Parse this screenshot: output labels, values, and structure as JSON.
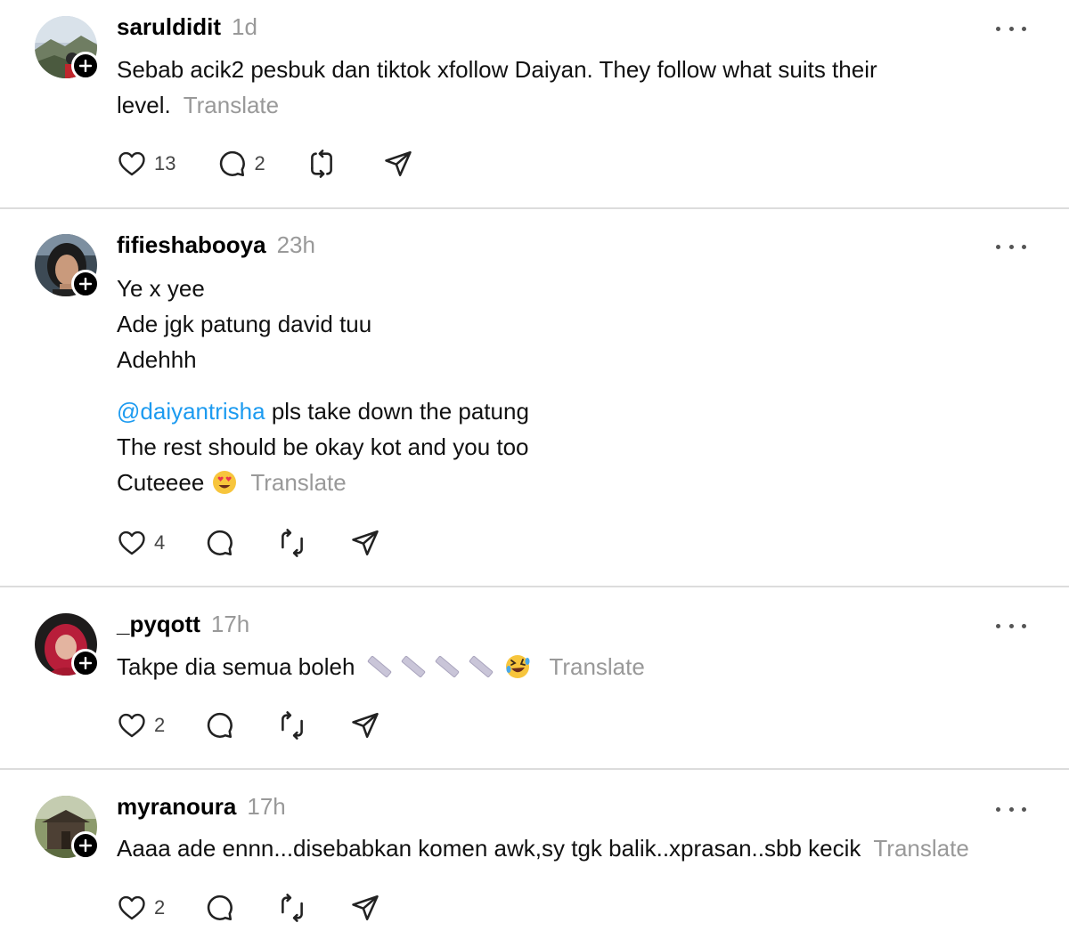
{
  "posts": [
    {
      "username": "saruldidit",
      "time": "1d",
      "lines": [
        "Sebab acik2 pesbuk dan tiktok xfollow Daiyan. They follow what suits their",
        "level."
      ],
      "translate": "Translate",
      "likes": "13",
      "replies": "2"
    },
    {
      "username": "fifieshabooya",
      "time": "23h",
      "lines_a": [
        "Ye x yee",
        "Ade jgk patung david tuu",
        "Adehhh"
      ],
      "mention": "@daiyantrisha",
      "mention_rest": " pls take down the patung",
      "lines_b": [
        "The rest should be okay kot and you too"
      ],
      "last_line": "Cuteeee",
      "translate": "Translate",
      "likes": "4"
    },
    {
      "username": "_pyqott",
      "time": "17h",
      "text": "Takpe dia semua boleh",
      "translate": "Translate",
      "likes": "2"
    },
    {
      "username": "myranoura",
      "time": "17h",
      "text": "Aaaa ade ennn...disebabkan komen awk,sy tgk balik..xprasan..sbb kecik",
      "translate": "Translate",
      "likes": "2"
    }
  ],
  "icons": {
    "like": "heart-icon",
    "reply": "speech-bubble-icon",
    "repost": "repost-icon",
    "share": "send-icon",
    "more": "ellipsis-icon",
    "follow": "plus-icon"
  },
  "colors": {
    "mention": "#1d9bf0",
    "muted": "#999999",
    "divider": "#dcdcdc"
  }
}
